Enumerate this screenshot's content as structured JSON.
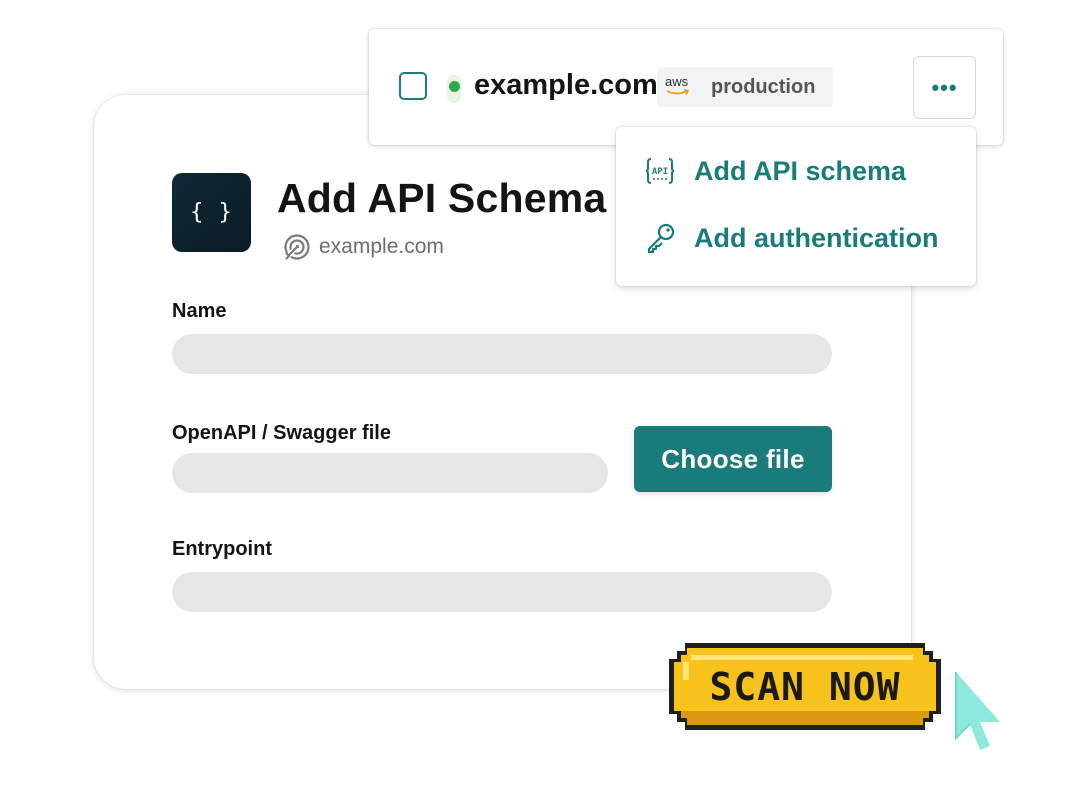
{
  "card": {
    "icon_text": "{ }",
    "title": "Add API Schema",
    "subtitle": "example.com",
    "subtitle_icon": "target-icon"
  },
  "form": {
    "name_label": "Name",
    "name_value": "",
    "file_label": "OpenAPI / Swagger file",
    "file_value": "",
    "choose_file_label": "Choose file",
    "entrypoint_label": "Entrypoint",
    "entrypoint_value": ""
  },
  "topbar": {
    "domain": "example.com",
    "status": "online",
    "provider_logo_text": "aws",
    "environment": "production",
    "more_icon": "more-horizontal-icon"
  },
  "menu": {
    "items": [
      {
        "label": "Add API schema",
        "icon": "api-icon"
      },
      {
        "label": "Add authentication",
        "icon": "key-icon"
      }
    ]
  },
  "cta": {
    "scan_label": "SCAN NOW"
  },
  "colors": {
    "accent": "#1a7b7b",
    "status_dot": "#2fa84a",
    "scan_button": "#f7c21c",
    "cursor": "#8ce9dc",
    "icon_bg": "#0e2a35"
  }
}
